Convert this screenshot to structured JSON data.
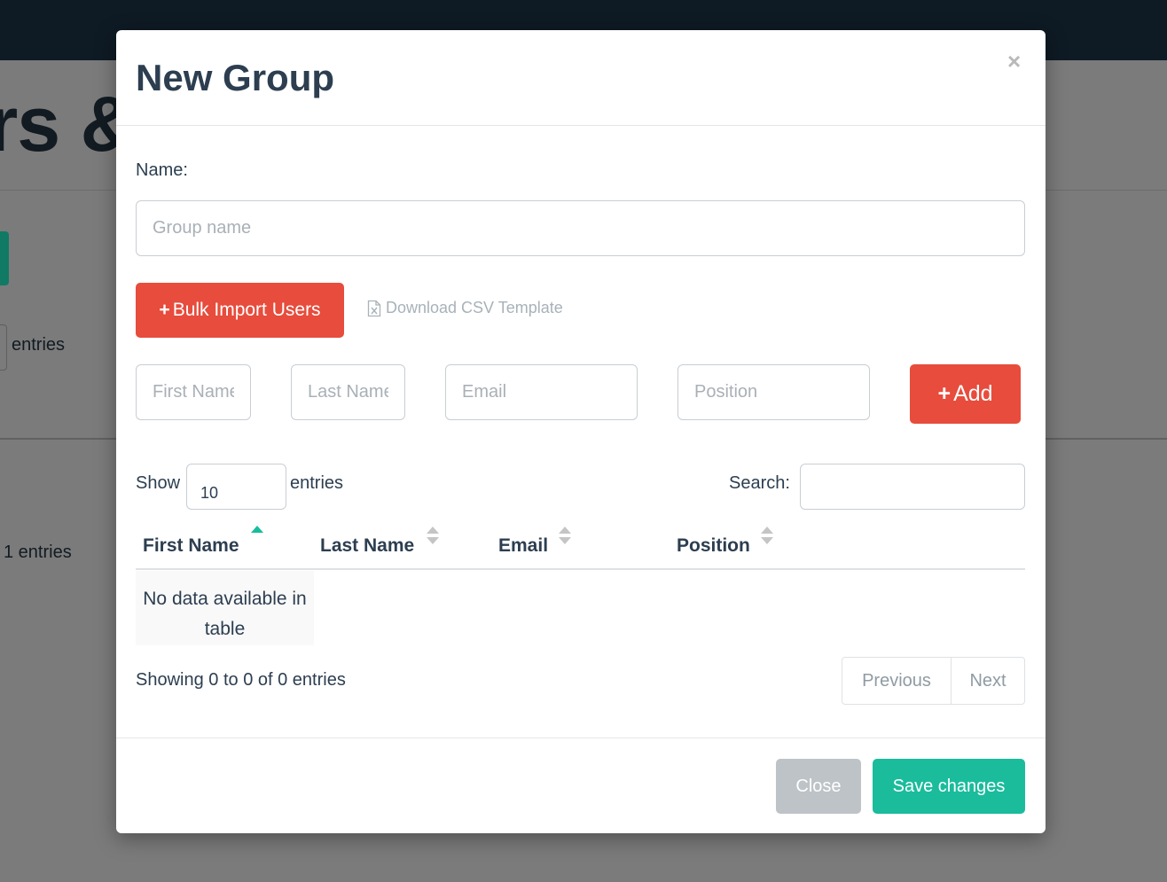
{
  "background": {
    "title_fragment": "rs &",
    "entries_label": "entries",
    "count_text": "1 entries"
  },
  "modal": {
    "title": "New Group",
    "close_symbol": "×",
    "name_label": "Name:",
    "group_name_placeholder": "Group name",
    "group_name_value": "",
    "bulk_import_label": "Bulk Import Users",
    "plus_symbol": "+",
    "download_csv_label": "Download CSV Template",
    "fields": {
      "first_name_placeholder": "First Name",
      "last_name_placeholder": "Last Name",
      "email_placeholder": "Email",
      "position_placeholder": "Position"
    },
    "add_label": "Add",
    "table_controls": {
      "show_label": "Show",
      "page_length": "10",
      "entries_label": "entries",
      "search_label": "Search:",
      "search_value": ""
    },
    "table": {
      "columns": [
        "First Name",
        "Last Name",
        "Email",
        "Position"
      ],
      "sorted_column": "First Name",
      "empty_message": "No data available in table"
    },
    "info_text": "Showing 0 to 0 of 0 entries",
    "pagination": {
      "previous": "Previous",
      "next": "Next"
    },
    "footer": {
      "close_label": "Close",
      "save_label": "Save changes"
    }
  },
  "colors": {
    "primary_red": "#e74c3c",
    "teal": "#1abc9c",
    "gray_button": "#bdc3c7",
    "navbar": "#0e1a24",
    "text_dark": "#2c3e50"
  },
  "icons": {
    "close": "close-icon",
    "plus": "plus-icon",
    "csv_file": "file-excel-icon",
    "sort": "sort-icon"
  }
}
